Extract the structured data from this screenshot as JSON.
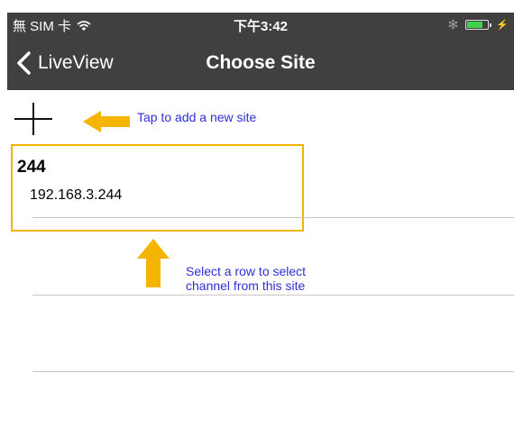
{
  "status_bar": {
    "carrier": "無 SIM 卡",
    "time": "下午3:42",
    "icons": [
      "wifi-icon",
      "bluetooth-icon",
      "battery-icon",
      "charging-icon"
    ]
  },
  "nav": {
    "back_label": "LiveView",
    "title": "Choose Site"
  },
  "toolbar": {
    "add_icon": "plus-icon"
  },
  "annotations": {
    "add_hint": "Tap to add a new site",
    "select_hint_line1": "Select a row to select",
    "select_hint_line2": "channel from this site",
    "highlight_color": "#f0b400",
    "arrow_color": "#f5b400",
    "hint_color": "#2f2fd8"
  },
  "sites": [
    {
      "name": "244",
      "address": "192.168.3.244"
    }
  ],
  "colors": {
    "bar_background": "#404040",
    "background": "#ffffff",
    "divider": "#c8c8c8"
  }
}
